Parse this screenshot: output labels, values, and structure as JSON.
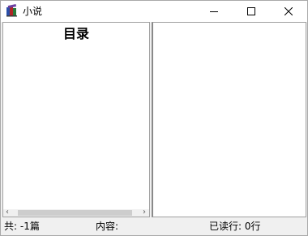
{
  "window": {
    "title": "小说",
    "app_icon": "books-app-icon"
  },
  "title_bar": {
    "minimize_icon": "minimize-icon",
    "maximize_icon": "maximize-icon",
    "close_icon": "close-icon"
  },
  "toc": {
    "title": "目录",
    "items": []
  },
  "content": {
    "text": ""
  },
  "status_bar": {
    "total": "共:  -1篇",
    "content": "内容:",
    "read_lines": "已读行: 0行"
  }
}
